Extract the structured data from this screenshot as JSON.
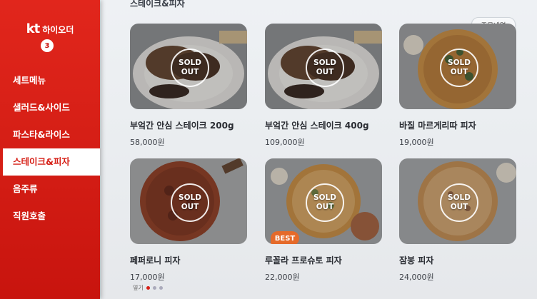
{
  "sidebar": {
    "brand_kt": "kt",
    "brand_name": "하이오더",
    "cart_count": "3",
    "items": [
      {
        "label": "세트메뉴",
        "active": false
      },
      {
        "label": "샐러드&사이드",
        "active": false
      },
      {
        "label": "파스타&라이스",
        "active": false
      },
      {
        "label": "스테이크&피자",
        "active": true
      },
      {
        "label": "음주류",
        "active": false
      },
      {
        "label": "직원호출",
        "active": false
      }
    ]
  },
  "main": {
    "section_title": "스테이크&피자",
    "order_history_label": "주문내역",
    "sold_out_label_top": "SOLD",
    "sold_out_label_bottom": "OUT",
    "best_badge": "BEST",
    "products": [
      {
        "name": "부엌간 안심 스테이크 200g",
        "price": "58,000원",
        "sold_out": true,
        "image": "steak-plate"
      },
      {
        "name": "부엌간 안심 스테이크 400g",
        "price": "109,000원",
        "sold_out": true,
        "image": "steak-plate"
      },
      {
        "name": "바질 마르게리따 피자",
        "price": "19,000원",
        "sold_out": true,
        "image": "margherita-pizza"
      },
      {
        "name": "페퍼로니 피자",
        "price": "17,000원",
        "sold_out": true,
        "image": "pepperoni-pizza"
      },
      {
        "name": "루꼴라 프로슈토 피자",
        "price": "22,000원",
        "sold_out": true,
        "image": "arugula-prosciutto-pizza",
        "best": true
      },
      {
        "name": "잠봉 피자",
        "price": "24,000원",
        "sold_out": true,
        "image": "jambon-pizza"
      }
    ],
    "pager_label": "옆기"
  },
  "colors": {
    "sidebar": "#d61f16",
    "active_text": "#d61f16",
    "best_badge": "#e56a2a"
  }
}
